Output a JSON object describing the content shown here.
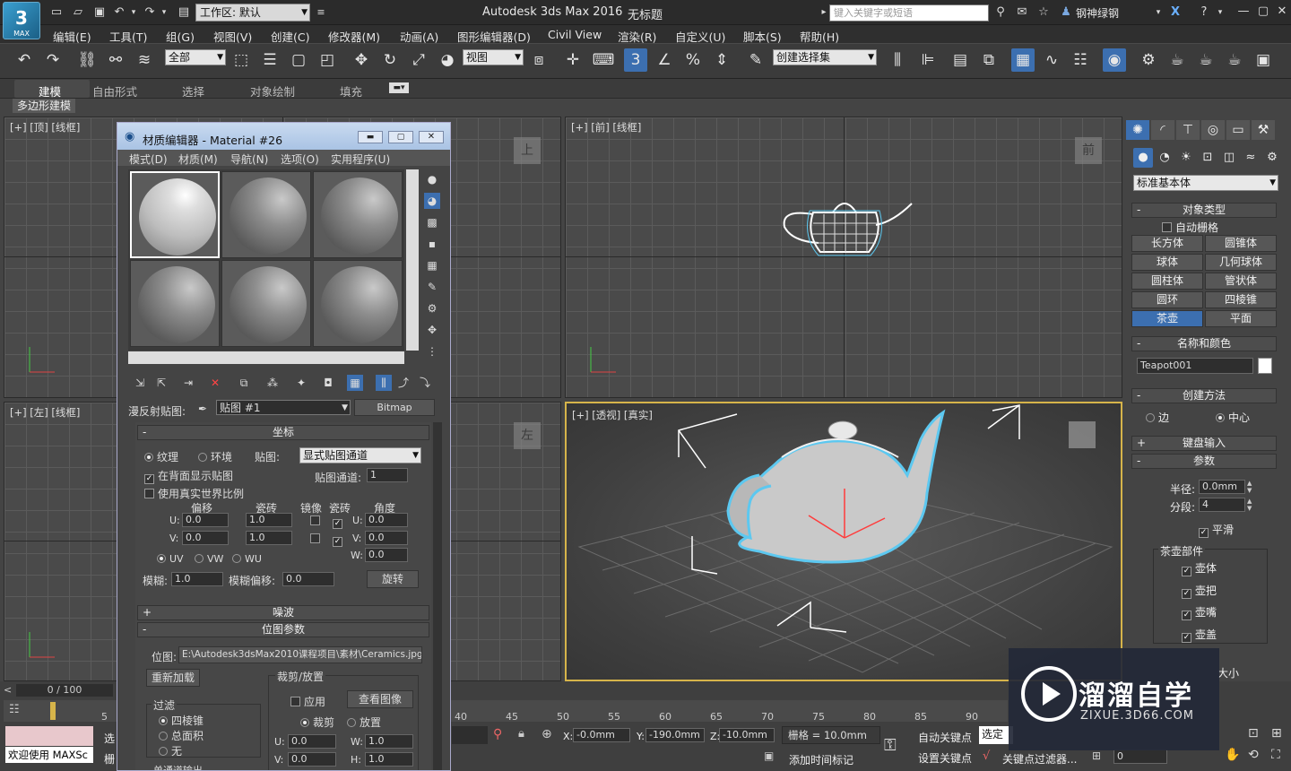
{
  "app": {
    "title": "Autodesk 3ds Max 2016",
    "document": "无标题",
    "workspace": "工作区: 默认",
    "search_placeholder": "键入关键字或短语",
    "user": "钢神绿钢",
    "logo_text": "MAX"
  },
  "menu": [
    "编辑(E)",
    "工具(T)",
    "组(G)",
    "视图(V)",
    "创建(C)",
    "修改器(M)",
    "动画(A)",
    "图形编辑器(D)",
    "Civil View",
    "渲染(R)",
    "自定义(U)",
    "脚本(S)",
    "帮助(H)"
  ],
  "toolbar": {
    "filter": "全部",
    "refcoord": "视图",
    "selection_set": "创建选择集",
    "snap_label": "3"
  },
  "ribbon": {
    "tabs": [
      "建模",
      "自由形式",
      "选择",
      "对象绘制",
      "填充"
    ],
    "sub": "多边形建模"
  },
  "viewports": {
    "top": "[+] [顶] [线框]",
    "front": "[+] [前] [线框]",
    "left": "[+] [左] [线框]",
    "persp": "[+] [透视] [真实]",
    "cube_top": "上",
    "cube_front": "前",
    "cube_left": "左"
  },
  "command_panel": {
    "category": "标准基本体",
    "object_type": {
      "header": "对象类型",
      "autogrid": "自动栅格",
      "buttons": [
        "长方体",
        "圆锥体",
        "球体",
        "几何球体",
        "圆柱体",
        "管状体",
        "圆环",
        "四棱锥",
        "茶壶",
        "平面"
      ],
      "active": "茶壶"
    },
    "name_color": {
      "header": "名称和颜色",
      "name": "Teapot001"
    },
    "creation_method": {
      "header": "创建方法",
      "edge": "边",
      "center": "中心"
    },
    "keyboard_entry": "键盘输入",
    "params": {
      "header": "参数",
      "radius_label": "半径:",
      "radius": "0.0mm",
      "segments_label": "分段:",
      "segments": "4",
      "smooth": "平滑",
      "parts_header": "茶壶部件",
      "parts": [
        "壶体",
        "壶把",
        "壶嘴",
        "壶盖"
      ],
      "size_label": "大小"
    }
  },
  "material_editor": {
    "title": "材质编辑器 - Material #26",
    "menu": [
      "模式(D)",
      "材质(M)",
      "导航(N)",
      "选项(O)",
      "实用程序(U)"
    ],
    "diffuse_label": "漫反射贴图:",
    "map_name": "贴图 #1",
    "map_type": "Bitmap",
    "coords": {
      "header": "坐标",
      "texture": "纹理",
      "environ": "环境",
      "mapping_label": "贴图:",
      "mapping": "显式贴图通道",
      "show_bg": "在背面显示贴图",
      "channel_label": "贴图通道:",
      "channel": "1",
      "real_world": "使用真实世界比例",
      "offset": "偏移",
      "tiling": "瓷砖",
      "mirror": "镜像",
      "tile": "瓷砖",
      "angle": "角度",
      "u_label": "U:",
      "v_label": "V:",
      "w_label": "W:",
      "u_offset": "0.0",
      "u_tiling": "1.0",
      "v_offset": "0.0",
      "v_tiling": "1.0",
      "u_angle": "0.0",
      "v_angle": "0.0",
      "w_angle": "0.0",
      "uv": "UV",
      "vw": "VW",
      "wu": "WU",
      "blur_label": "模糊:",
      "blur": "1.0",
      "blur_offset_label": "模糊偏移:",
      "blur_offset": "0.0",
      "rotate": "旋转"
    },
    "noise": "噪波",
    "bitmap": {
      "header": "位图参数",
      "path_label": "位图:",
      "path": "E:\\Autodesk3dsMax2010课程项目\\素材\\Ceramics.jpg",
      "reload": "重新加载",
      "crop_header": "裁剪/放置",
      "filter_header": "过滤",
      "pyramid": "四棱锥",
      "summed": "总面积",
      "none": "无",
      "apply": "应用",
      "view_image": "查看图像",
      "crop": "裁剪",
      "place": "放置",
      "u_label": "U:",
      "v_label": "V:",
      "w_label": "W:",
      "h_label": "H:",
      "u": "0.0",
      "v": "0.0",
      "w": "1.0",
      "h": "1.0",
      "mono_output": "单通道输出"
    }
  },
  "status": {
    "frame": "0 / 100",
    "ticks": [
      "5",
      "40",
      "45",
      "50",
      "55",
      "60",
      "65",
      "70",
      "75",
      "80",
      "85",
      "90"
    ],
    "welcome": "欢迎使用 MAXSc",
    "x_label": "X:",
    "x": "-0.0mm",
    "y_label": "Y:",
    "y": "-190.0mm",
    "z_label": "Z:",
    "z": "-10.0mm",
    "grid": "栅格 = 10.0mm",
    "auto_key": "自动关键点",
    "set_key": "设置关键点",
    "selected": "选定对",
    "key_filter": "关键点过滤器...",
    "add_time_tag": "添加时间标记",
    "frame_field": "0",
    "select_left": "选",
    "render_left": "栅"
  },
  "watermark": {
    "title": "溜溜自学",
    "sub": "ZIXUE.3D66.COM"
  }
}
